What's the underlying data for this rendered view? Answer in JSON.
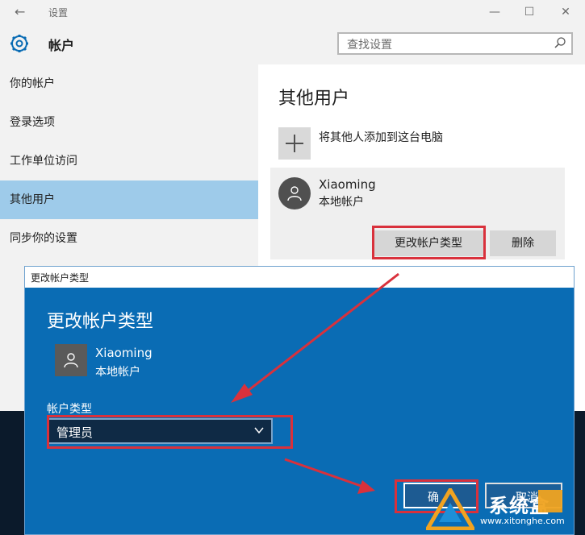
{
  "colors": {
    "accent": "#0a6cb4",
    "selected_nav": "#9ecbea",
    "highlight_red": "#d9313c",
    "watermark_orange": "#f0a320"
  },
  "settings_window": {
    "title": "设置",
    "header": "帐户",
    "window_controls": [
      "minimize-icon",
      "maximize-icon",
      "close-icon"
    ],
    "search": {
      "placeholder": "查找设置",
      "icon": "search-icon"
    }
  },
  "sidebar": {
    "items": [
      {
        "label": "你的帐户",
        "selected": false
      },
      {
        "label": "登录选项",
        "selected": false
      },
      {
        "label": "工作单位访问",
        "selected": false
      },
      {
        "label": "其他用户",
        "selected": true
      },
      {
        "label": "同步你的设置",
        "selected": false
      }
    ]
  },
  "content": {
    "title": "其他用户",
    "add_user_label": "将其他人添加到这台电脑",
    "user": {
      "name": "Xiaoming",
      "type": "本地帐户"
    },
    "buttons": {
      "change_type": "更改帐户类型",
      "delete": "删除"
    }
  },
  "dialog": {
    "window_title": "更改帐户类型",
    "heading": "更改帐户类型",
    "user": {
      "name": "Xiaoming",
      "type": "本地帐户"
    },
    "account_type_label": "帐户类型",
    "account_type_value": "管理员",
    "ok_label": "确",
    "cancel_label": "取消"
  },
  "watermark": {
    "title": "系统盒",
    "url": "www.xitonghe.com"
  }
}
